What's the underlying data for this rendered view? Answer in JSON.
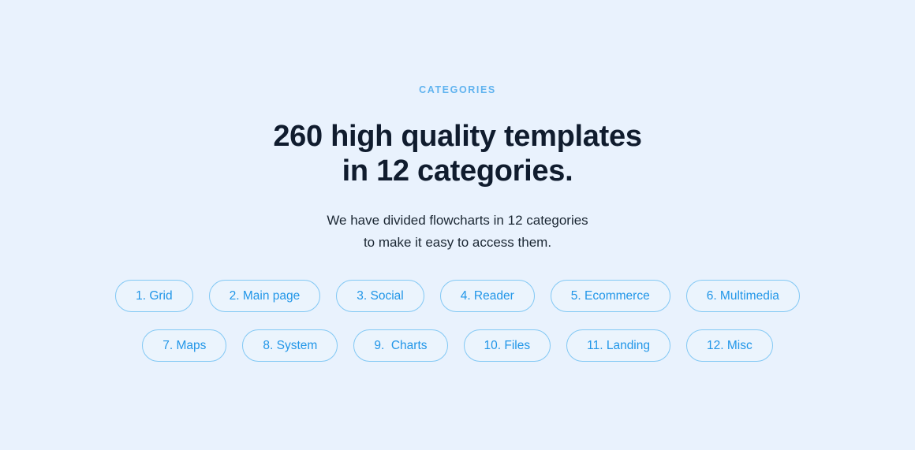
{
  "section": {
    "eyebrow": "CATEGORIES",
    "headline_lines": [
      "260 high quality templates",
      "in 12 categories."
    ],
    "subtitle_lines": [
      "We have divided flowcharts in 12 categories",
      "to make it easy to access them."
    ],
    "colors": {
      "background": "#e9f2fd",
      "eyebrow": "#60b3ef",
      "headline": "#101c2e",
      "subtitle": "#1b2733",
      "pill_text": "#2196e8",
      "pill_border": "#82c8f4",
      "pill_fill": "#ebf4fd"
    },
    "pill_rows": [
      {
        "pills": [
          {
            "label": "1. Grid"
          },
          {
            "label": "2. Main page"
          },
          {
            "label": "3. Social"
          },
          {
            "label": "4. Reader"
          },
          {
            "label": "5. Ecommerce"
          },
          {
            "label": "6. Multimedia"
          }
        ]
      },
      {
        "pills": [
          {
            "label": "7. Maps"
          },
          {
            "label": "8. System"
          },
          {
            "label": "9.  Charts"
          },
          {
            "label": "10. Files"
          },
          {
            "label": "11. Landing"
          },
          {
            "label": "12. Misc"
          }
        ]
      }
    ]
  }
}
